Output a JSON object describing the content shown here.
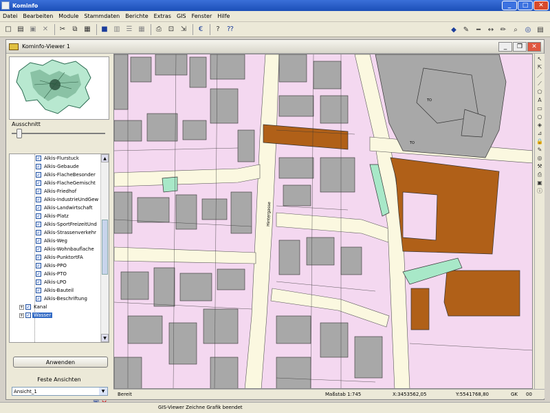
{
  "window": {
    "title": "Kominfo"
  },
  "menu": [
    "Datei",
    "Bearbeiten",
    "Module",
    "Stammdaten",
    "Berichte",
    "Extras",
    "GIS",
    "Fenster",
    "Hilfe"
  ],
  "viewer": {
    "title": "Kominfo-Viewer 1"
  },
  "overview": {
    "zoom_label": "Ausschnitt",
    "zoom_level": 0.05
  },
  "layers": [
    {
      "label": "Alkis-Flurstuck",
      "checked": true
    },
    {
      "label": "Alkis-Gebaude",
      "checked": true
    },
    {
      "label": "Alkis-FlacheBesonder",
      "checked": true
    },
    {
      "label": "Alkis-FlacheGemischt",
      "checked": true
    },
    {
      "label": "Alkis-Friedhof",
      "checked": true
    },
    {
      "label": "Alkis-IndustrieUndGew",
      "checked": true
    },
    {
      "label": "Alkis-Landwirtschaft",
      "checked": true
    },
    {
      "label": "Alkis-Platz",
      "checked": true
    },
    {
      "label": "Alkis-SportFreizeitUnd",
      "checked": true
    },
    {
      "label": "Alkis-Strassenverkehr",
      "checked": true
    },
    {
      "label": "Alkis-Weg",
      "checked": true
    },
    {
      "label": "Alkis-Wohnbauflache",
      "checked": true
    },
    {
      "label": "Alkis-PunktortFA",
      "checked": true
    },
    {
      "label": "Alkis-PPO",
      "checked": true
    },
    {
      "label": "Alkis-PTO",
      "checked": true
    },
    {
      "label": "Alkis-LPO",
      "checked": true
    },
    {
      "label": "Alkis-Bauteil",
      "checked": true
    },
    {
      "label": "Alkis-Beschriftung",
      "checked": true
    }
  ],
  "groups": [
    {
      "label": "Kanal",
      "selected": false
    },
    {
      "label": "Wasser",
      "selected": true
    }
  ],
  "left": {
    "apply_label": "Anwenden",
    "fixed_views_label": "Feste Ansichten",
    "view_selected": "Ansicht_1"
  },
  "map": {
    "street_label": "Hintergasse",
    "labels": [
      "TO",
      "TO"
    ]
  },
  "mapstatus": {
    "state": "Bereit",
    "scale": "Maßstab 1:745",
    "x": "X:3453562,05",
    "y": "Y:5541768,80",
    "gk": "GK",
    "zone": "00"
  },
  "status": {
    "message": "GIS-Viewer Zeichne Grafik beendet"
  },
  "colors": {
    "building_gray": "#a8a8a8",
    "parcel_pink": "#f4d8f0",
    "street_cream": "#fbf8e0",
    "public_brown": "#b06018",
    "green": "#a8e8c8"
  }
}
